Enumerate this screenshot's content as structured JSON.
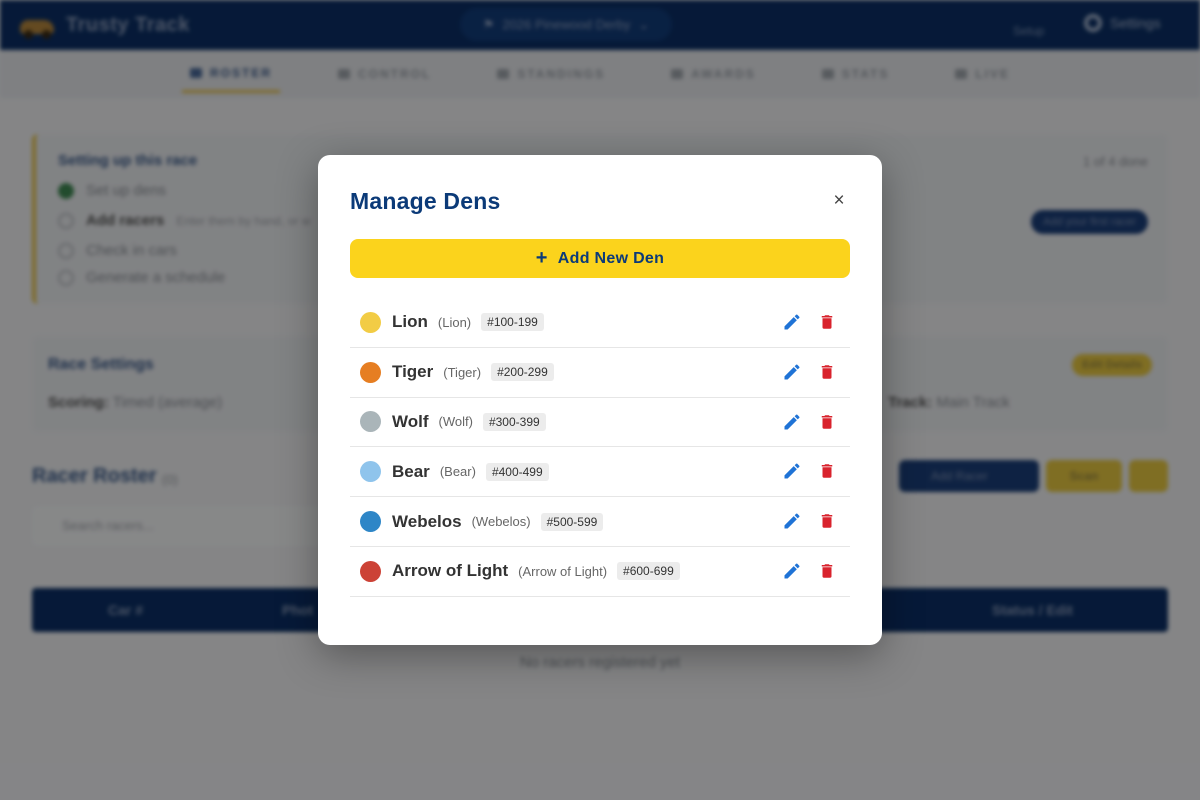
{
  "app": {
    "brand": "Trusty Track",
    "race_select": "2026 Pinewood Derby",
    "setup_link": "Setup",
    "settings_label": "Settings"
  },
  "tabs": [
    {
      "label": "ROSTER",
      "active": true
    },
    {
      "label": "CONTROL"
    },
    {
      "label": "STANDINGS"
    },
    {
      "label": "AWARDS"
    },
    {
      "label": "STATS"
    },
    {
      "label": "LIVE"
    }
  ],
  "setup": {
    "title": "Setting up this race",
    "progress": "1 of 4 done",
    "steps": [
      {
        "label": "Set up dens",
        "done": true
      },
      {
        "label": "Add racers",
        "hint": "Enter them by hand, or w"
      },
      {
        "label": "Check in cars"
      },
      {
        "label": "Generate a schedule"
      }
    ],
    "first_racer_button": "Add your first racer"
  },
  "race_settings": {
    "title": "Race Settings",
    "scoring_label": "Scoring:",
    "scoring_value": "Timed (average)",
    "track_label": "Track:",
    "track_value": "Main Track",
    "edit_button": "Edit Details"
  },
  "roster": {
    "title": "Racer Roster",
    "count": "(0)",
    "add_button": "Add Racer",
    "scan_button": "Scan",
    "search_placeholder": "Search racers...",
    "columns": [
      "Car #",
      "Phot",
      "Status / Edit"
    ],
    "empty_message": "No racers registered yet"
  },
  "modal": {
    "title": "Manage Dens",
    "close": "×",
    "add_button": "Add New Den",
    "dens": [
      {
        "name": "Lion",
        "sub": "(Lion)",
        "range": "#100-199",
        "color": "#f2cc45"
      },
      {
        "name": "Tiger",
        "sub": "(Tiger)",
        "range": "#200-299",
        "color": "#e67e22"
      },
      {
        "name": "Wolf",
        "sub": "(Wolf)",
        "range": "#300-399",
        "color": "#aab5b9"
      },
      {
        "name": "Bear",
        "sub": "(Bear)",
        "range": "#400-499",
        "color": "#8fc4ec"
      },
      {
        "name": "Webelos",
        "sub": "(Webelos)",
        "range": "#500-599",
        "color": "#2e86c7"
      },
      {
        "name": "Arrow of Light",
        "sub": "(Arrow of Light)",
        "range": "#600-699",
        "color": "#cc4236"
      }
    ]
  },
  "colors": {
    "accent_yellow": "#fbd31c",
    "primary_blue": "#0b3a78",
    "edit_blue": "#1f73d6",
    "delete_red": "#d9232d"
  }
}
